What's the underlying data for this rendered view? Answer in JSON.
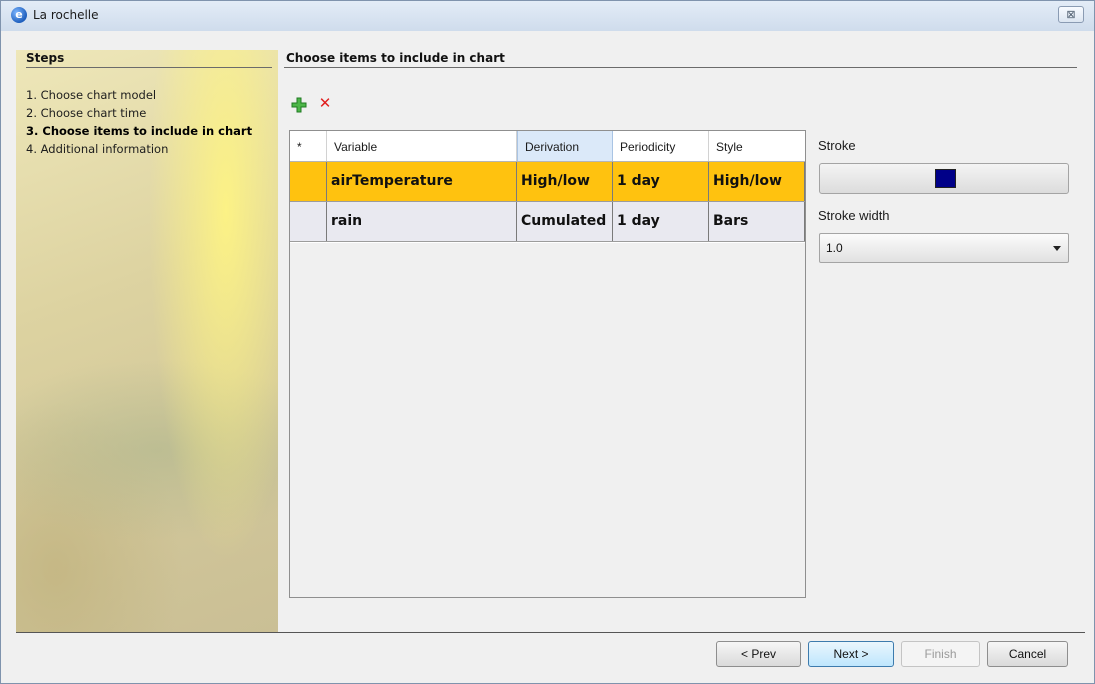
{
  "window": {
    "title": "La rochelle",
    "app_icon_letter": "e",
    "close_glyph": "⊠"
  },
  "steps": {
    "header": "Steps",
    "items": [
      {
        "label": "1. Choose chart model"
      },
      {
        "label": "2. Choose chart time"
      },
      {
        "label": "3. Choose items to include in chart",
        "current": true
      },
      {
        "label": "4. Additional information"
      }
    ]
  },
  "main": {
    "title": "Choose items to include in chart",
    "toolbar": {
      "add_icon": "add-icon",
      "remove_icon": "remove-icon",
      "remove_glyph": "✕"
    },
    "table": {
      "columns": [
        "*",
        "Variable",
        "Derivation",
        "Periodicity",
        "Style"
      ],
      "sorted_column": "Derivation",
      "rows": [
        {
          "marker": "",
          "variable": "airTemperature",
          "derivation": "High/low",
          "periodicity": "1 day",
          "style": "High/low",
          "selected": true
        },
        {
          "marker": "",
          "variable": "rain",
          "derivation": "Cumulated",
          "periodicity": "1 day",
          "style": "Bars",
          "selected": false
        }
      ]
    },
    "properties": {
      "stroke_label": "Stroke",
      "stroke_color": "#000088",
      "stroke_width_label": "Stroke width",
      "stroke_width_value": "1.0"
    }
  },
  "footer": {
    "prev_label": "< Prev",
    "next_label": "Next >",
    "finish_label": "Finish",
    "cancel_label": "Cancel"
  },
  "colors": {
    "selected_row": "#ffc20f",
    "normal_row": "#e9e9f0",
    "sorted_header": "#dbe9f9"
  }
}
